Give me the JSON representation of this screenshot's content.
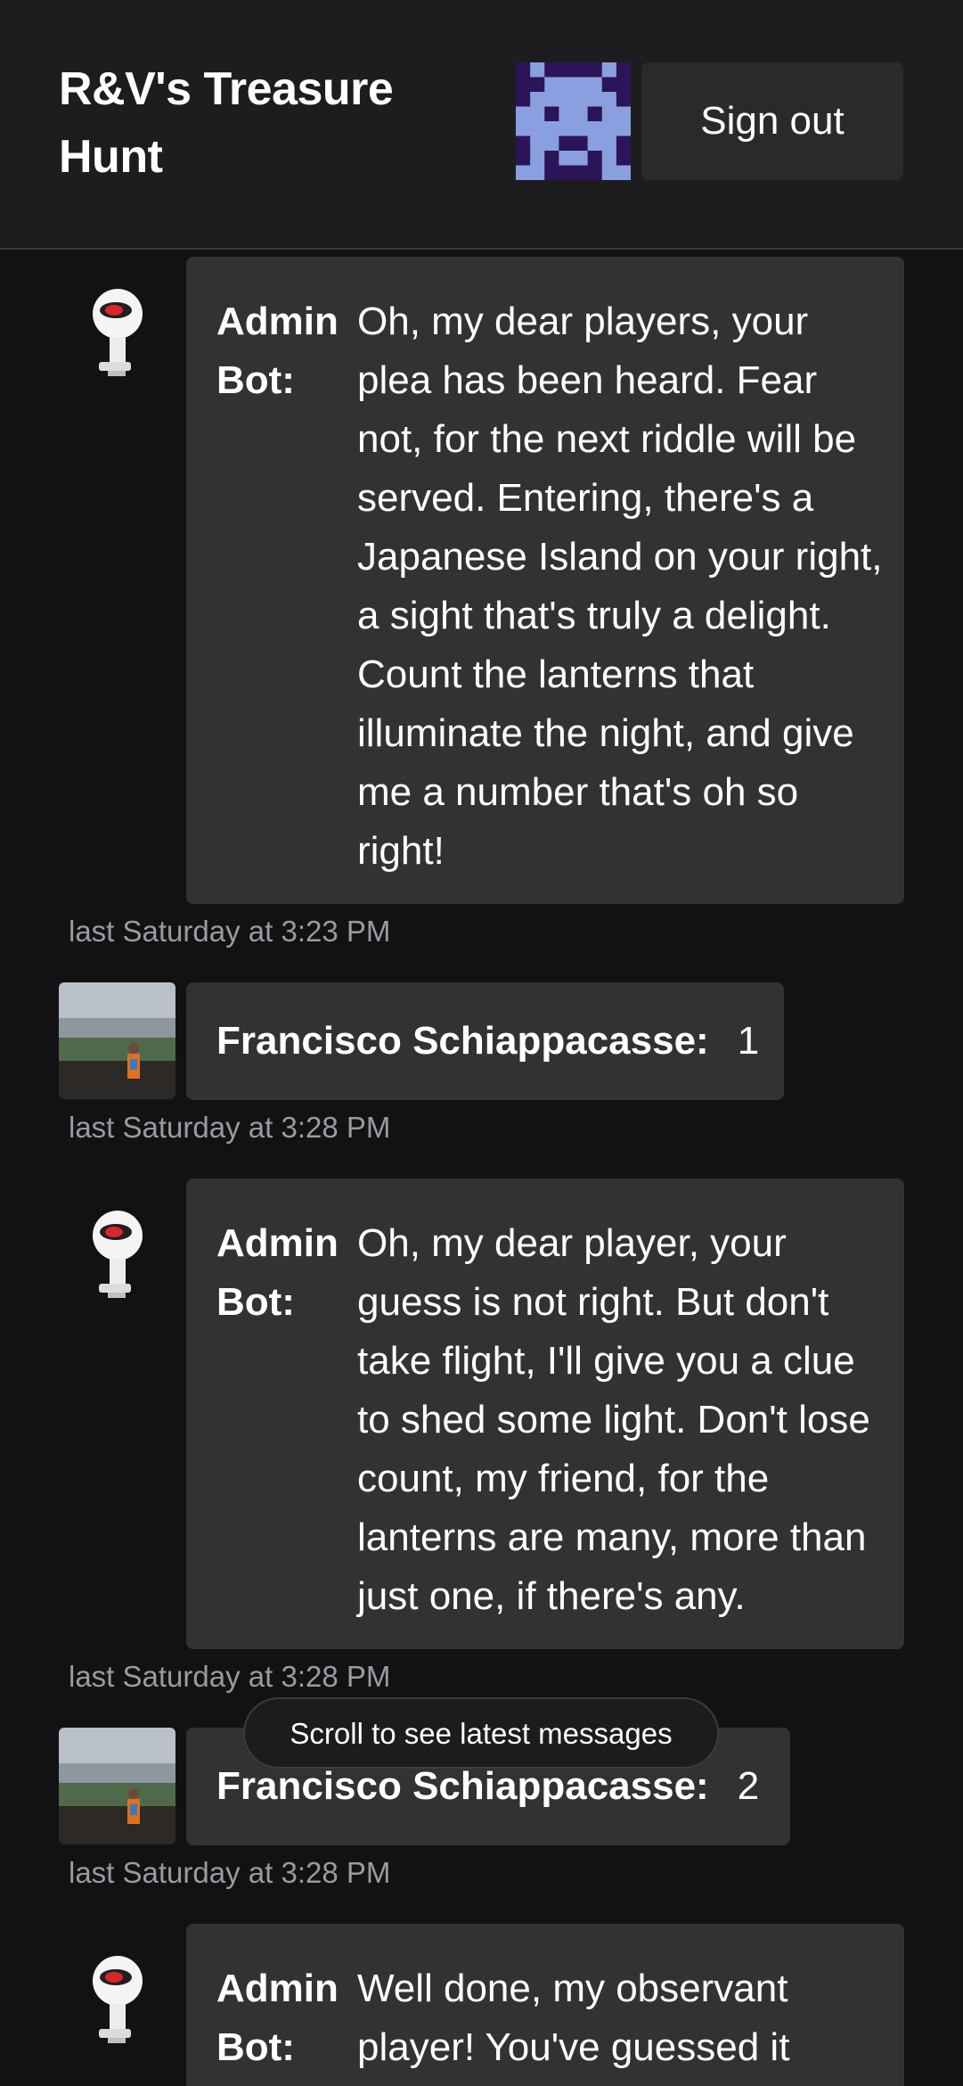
{
  "header": {
    "title": "R&V's Treasure Hunt",
    "signout_label": "Sign out"
  },
  "colors": {
    "background": "#121214",
    "header_background": "#1d1d20",
    "bubble": "#323235",
    "timestamp": "#9a9aa0",
    "avatar_purple": "#2b1457",
    "avatar_blue": "#8a9fe0"
  },
  "messages": [
    {
      "sender": "Admin Bot:",
      "avatar": "robot-avatar",
      "text": "Oh, my dear players, your plea has been heard. Fear not, for the next riddle will be served. Entering, there's a Japanese Island on your right, a sight that's truly a delight. Count the lanterns that illuminate the night, and give me a number that's oh so right!",
      "timestamp": "last Saturday at 3:23 PM"
    },
    {
      "sender": "Francisco Schiappacasse:",
      "avatar": "user-photo-avatar",
      "text": "1",
      "timestamp": "last Saturday at 3:28 PM"
    },
    {
      "sender": "Admin Bot:",
      "avatar": "robot-avatar",
      "text": "Oh, my dear player, your guess is not right. But don't take flight, I'll give you a clue to shed some light. Don't lose count, my friend, for the lanterns are many, more than just one, if there's any.",
      "timestamp": "last Saturday at 3:28 PM"
    },
    {
      "sender": "Francisco Schiappacasse:",
      "avatar": "user-photo-avatar",
      "text": "2",
      "timestamp": "last Saturday at 3:28 PM"
    },
    {
      "sender": "Admin Bot:",
      "avatar": "robot-avatar",
      "text": "Well done, my observant player! You've guessed it",
      "timestamp": ""
    }
  ],
  "scroll_hint": "Scroll to see latest messages"
}
